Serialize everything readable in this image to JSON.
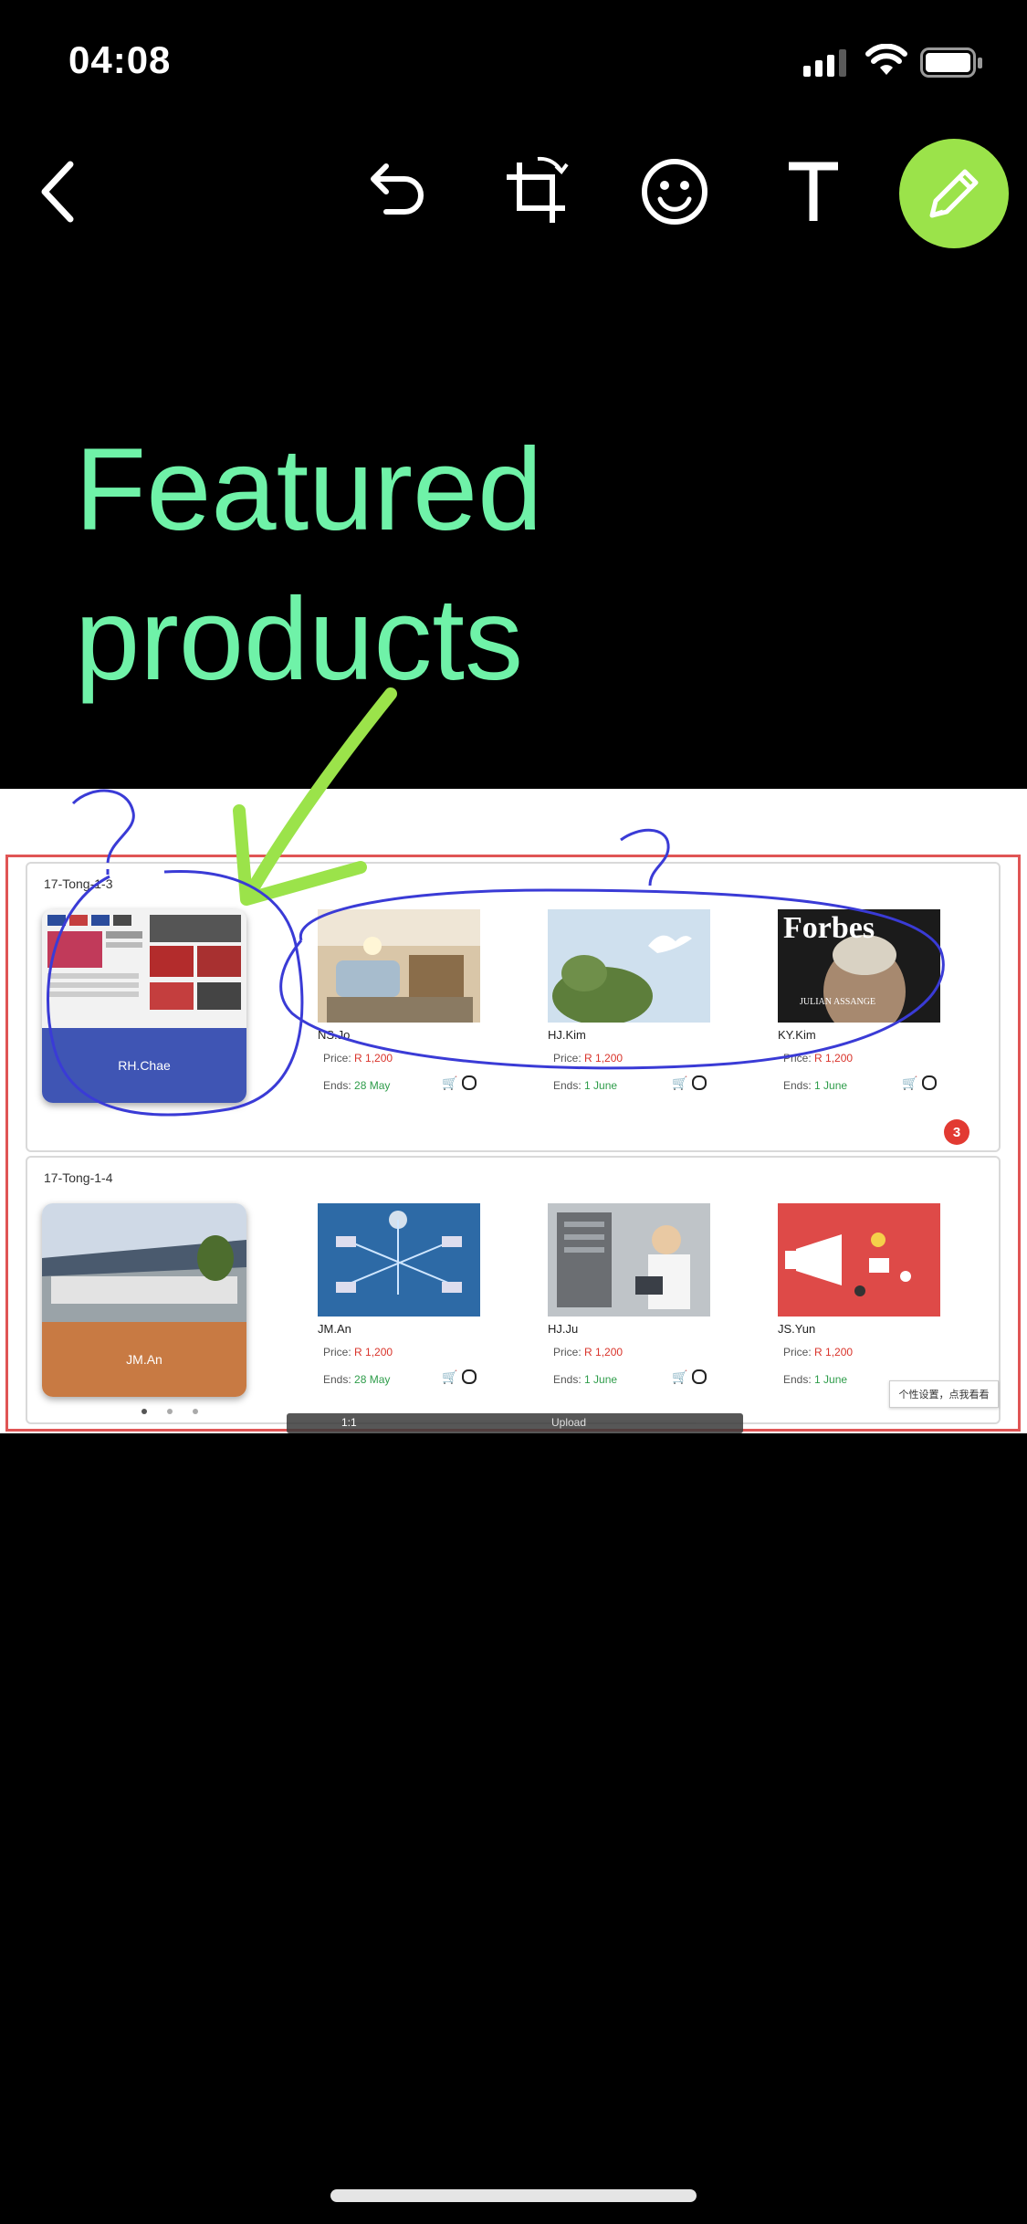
{
  "status_bar": {
    "time": "04:08",
    "icons": [
      "cellular-signal-icon",
      "wifi-icon",
      "battery-icon"
    ]
  },
  "toolbar": {
    "buttons": [
      "back-icon",
      "undo-icon",
      "crop-rotate-icon",
      "emoji-icon",
      "text-icon",
      "pencil-icon"
    ],
    "active": "pencil",
    "active_color": "#9be34a"
  },
  "annotation": {
    "text_line1": "Featured",
    "text_line2": "products",
    "text_color": "#6ff2a8",
    "arrow_color": "#9be34a",
    "scribble_color": "#3a3bd6"
  },
  "photo": {
    "section1": {
      "label": "17-Tong-1-3",
      "featured": {
        "name": "RH.Chae",
        "color": "#3f55b4"
      },
      "products": [
        {
          "name": "NS.Jo",
          "price_label": "Price:",
          "price": "R 1,200",
          "ends_label": "Ends:",
          "ends": "28 May"
        },
        {
          "name": "HJ.Kim",
          "price_label": "Price:",
          "price": "R 1,200",
          "ends_label": "Ends:",
          "ends": "1 June"
        },
        {
          "name": "KY.Kim",
          "price_label": "Price:",
          "price": "R 1,200",
          "ends_label": "Ends:",
          "ends": "1 June",
          "image_title": "Forbes",
          "image_subtitle": "JULIAN ASSANGE"
        }
      ]
    },
    "badge": "3",
    "section2": {
      "label": "17-Tong-1-4",
      "featured": {
        "name": "JM.An",
        "color": "#c87a43"
      },
      "products": [
        {
          "name": "JM.An",
          "price_label": "Price:",
          "price": "R 1,200",
          "ends_label": "Ends:",
          "ends": "28 May"
        },
        {
          "name": "HJ.Ju",
          "price_label": "Price:",
          "price": "R 1,200",
          "ends_label": "Ends:",
          "ends": "1 June"
        },
        {
          "name": "JS.Yun",
          "price_label": "Price:",
          "price": "R 1,200",
          "ends_label": "Ends:",
          "ends": "1 June"
        }
      ]
    },
    "tooltip": "个性设置，点我看看",
    "video_bar": {
      "speed": "1:1",
      "upload": "Upload"
    }
  }
}
